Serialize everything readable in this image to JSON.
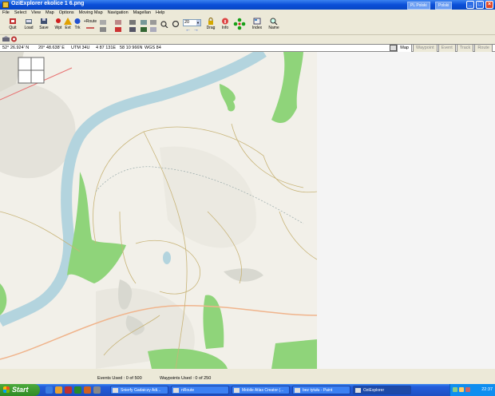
{
  "window": {
    "title": "OziExplorer   ekolice 1 6.png",
    "lang_left": "PL Polski",
    "lang_right": "Polski"
  },
  "menu": [
    "File",
    "Select",
    "View",
    "Map",
    "Options",
    "Moving Map",
    "Navigation",
    "Magellan",
    "Help"
  ],
  "toolbar": {
    "quit": "Quit",
    "load": "Load",
    "save": "Save",
    "wpt": "Wpt",
    "evt": "Evt",
    "trk": "Trk",
    "route_label": "+Route",
    "zoom_value": "20",
    "drag": "Drag",
    "info": "Info",
    "index": "Index",
    "name": "Name"
  },
  "status": {
    "lat": "52° 26.924' N",
    "lon": "20° 48.638' E",
    "utm": "UTM  34U",
    "easting": "4 87 131E",
    "northing": "58 10 966N",
    "datum": "WGS 84"
  },
  "tabs": [
    "Map",
    "Waypoint",
    "Event",
    "Track",
    "Route"
  ],
  "footer": {
    "events": "Events Used : 0 of 500",
    "waypoints": "Waypoints Used : 0 of 250"
  },
  "taskbar": {
    "start": "Start",
    "tasks": [
      "Snierfy Gadaiczy Adi...",
      "nRoute",
      "Mobile Atlas Creator (...",
      "bez tytułu - Paint",
      "OziExplorer"
    ],
    "clock": "22:37"
  },
  "colors": {
    "forest": "#8fd47a",
    "river": "#b3d4de",
    "road": "#f0b48c",
    "path": "#c8b478",
    "background": "#f2f0e9"
  }
}
